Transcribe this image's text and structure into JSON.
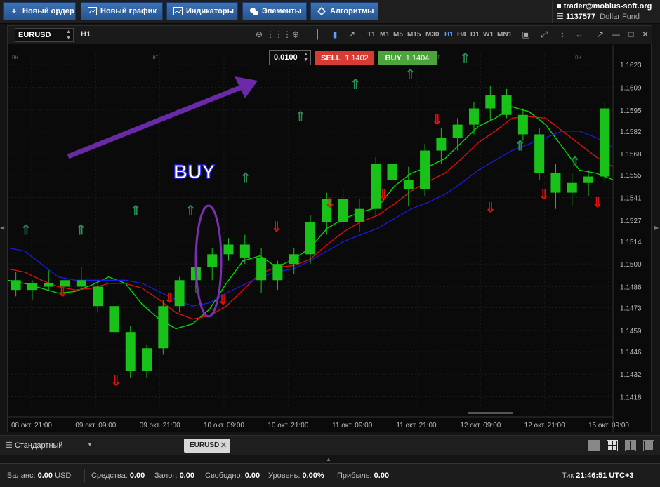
{
  "toolbar": {
    "buttons": [
      {
        "label": "Новый ордер",
        "icon": "plus-icon"
      },
      {
        "label": "Новый график",
        "icon": "chart-icon"
      },
      {
        "label": "Индикаторы",
        "icon": "indicator-icon"
      },
      {
        "label": "Элементы",
        "icon": "shapes-icon"
      },
      {
        "label": "Алгоритмы",
        "icon": "diamond-icon"
      }
    ],
    "user_email": "trader@mobius-soft.org",
    "account_number": "1137577",
    "account_type": "Dollar Fund"
  },
  "chart_toolbar": {
    "symbol": "EURUSD",
    "timeframe": "H1",
    "timeframes": [
      "T1",
      "M1",
      "M5",
      "M15",
      "M30",
      "H1",
      "H4",
      "D1",
      "W1",
      "MN1"
    ],
    "active_timeframe": "H1"
  },
  "order": {
    "lot": "0.0100",
    "sell_label": "SELL",
    "sell_price": "1.1402",
    "buy_label": "BUY",
    "buy_price": "1.1404"
  },
  "annotation": {
    "text": "BUY",
    "arrow_color": "#6a2aa8"
  },
  "chart_data": {
    "type": "candlestick",
    "symbol": "EURUSD",
    "timeframe": "H1",
    "y_ticks": [
      "1.1623",
      "1.1609",
      "1.1595",
      "1.1582",
      "1.1568",
      "1.1555",
      "1.1541",
      "1.1527",
      "1.1514",
      "1.1500",
      "1.1486",
      "1.1473",
      "1.1459",
      "1.1446",
      "1.1432",
      "1.1418"
    ],
    "ylim": [
      1.141,
      1.163
    ],
    "day_labels": [
      "пн",
      "вт",
      "ср",
      "пт",
      "пн"
    ],
    "x_ticks": [
      "08 окт. 21:00",
      "09 окт. 09:00",
      "09 окт. 21:00",
      "10 окт. 09:00",
      "10 окт. 21:00",
      "11 окт. 09:00",
      "11 окт. 21:00",
      "12 окт. 09:00",
      "12 окт. 21:00",
      "15 окт. 09:00"
    ],
    "series": [
      {
        "color": "#00e000",
        "values": [
          1.149,
          1.1488,
          1.1485,
          1.1482,
          1.1483,
          1.1487,
          1.1492,
          1.1488,
          1.1475,
          1.1466,
          1.146,
          1.1463,
          1.1472,
          1.1488,
          1.1502,
          1.1505,
          1.1498,
          1.1503,
          1.151,
          1.1522,
          1.1528,
          1.1532,
          1.1535,
          1.1548,
          1.1556,
          1.156,
          1.1565,
          1.1575,
          1.1585,
          1.159,
          1.1597,
          1.1594,
          1.1586,
          1.1572,
          1.1558,
          1.1556,
          1.1552
        ]
      },
      {
        "color": "#e01010",
        "values": [
          1.1497,
          1.1495,
          1.149,
          1.1486,
          1.1484,
          1.1485,
          1.1488,
          1.1488,
          1.1485,
          1.1478,
          1.147,
          1.1466,
          1.1468,
          1.1474,
          1.1484,
          1.1494,
          1.1498,
          1.1499,
          1.1503,
          1.1512,
          1.152,
          1.1526,
          1.153,
          1.1537,
          1.1545,
          1.1551,
          1.1556,
          1.1565,
          1.1575,
          1.1582,
          1.159,
          1.1591,
          1.159,
          1.1582,
          1.1574,
          1.1566,
          1.156
        ]
      },
      {
        "color": "#1a1ae0",
        "values": [
          1.151,
          1.1508,
          1.15,
          1.1492,
          1.149,
          1.149,
          1.149,
          1.149,
          1.1488,
          1.1483,
          1.1478,
          1.1474,
          1.1476,
          1.1482,
          1.1487,
          1.1492,
          1.1495,
          1.1497,
          1.1502,
          1.1508,
          1.1514,
          1.1518,
          1.1522,
          1.1528,
          1.1534,
          1.1538,
          1.1543,
          1.155,
          1.1558,
          1.1564,
          1.157,
          1.1574,
          1.1578,
          1.1582,
          1.1582,
          1.1578,
          1.1572
        ]
      }
    ],
    "candles": [
      [
        1.149,
        1.1495,
        1.148,
        1.1484
      ],
      [
        1.1484,
        1.149,
        1.1478,
        1.1488
      ],
      [
        1.1488,
        1.1496,
        1.1484,
        1.1486
      ],
      [
        1.1486,
        1.1492,
        1.148,
        1.149
      ],
      [
        1.149,
        1.1498,
        1.1484,
        1.1486
      ],
      [
        1.1486,
        1.149,
        1.147,
        1.1474
      ],
      [
        1.1474,
        1.1478,
        1.1455,
        1.1458
      ],
      [
        1.1458,
        1.1462,
        1.143,
        1.1434
      ],
      [
        1.1434,
        1.145,
        1.143,
        1.1448
      ],
      [
        1.1448,
        1.1478,
        1.1444,
        1.1474
      ],
      [
        1.1474,
        1.1492,
        1.147,
        1.149
      ],
      [
        1.149,
        1.15,
        1.1482,
        1.1498
      ],
      [
        1.1498,
        1.151,
        1.149,
        1.1506
      ],
      [
        1.1506,
        1.1516,
        1.1502,
        1.1512
      ],
      [
        1.1512,
        1.1518,
        1.15,
        1.1504
      ],
      [
        1.1504,
        1.151,
        1.1482,
        1.149
      ],
      [
        1.149,
        1.1502,
        1.1484,
        1.15
      ],
      [
        1.15,
        1.151,
        1.1494,
        1.1506
      ],
      [
        1.1506,
        1.153,
        1.15,
        1.1526
      ],
      [
        1.1526,
        1.1544,
        1.1518,
        1.154
      ],
      [
        1.154,
        1.1546,
        1.1522,
        1.1526
      ],
      [
        1.1526,
        1.154,
        1.152,
        1.1534
      ],
      [
        1.1534,
        1.1566,
        1.153,
        1.1562
      ],
      [
        1.1562,
        1.1568,
        1.1548,
        1.1552
      ],
      [
        1.1552,
        1.156,
        1.1536,
        1.1546
      ],
      [
        1.1546,
        1.1574,
        1.1542,
        1.157
      ],
      [
        1.157,
        1.1584,
        1.1562,
        1.1578
      ],
      [
        1.1578,
        1.159,
        1.157,
        1.1586
      ],
      [
        1.1586,
        1.16,
        1.158,
        1.1596
      ],
      [
        1.1596,
        1.161,
        1.1588,
        1.1604
      ],
      [
        1.1604,
        1.1608,
        1.159,
        1.1592
      ],
      [
        1.1592,
        1.1596,
        1.1576,
        1.158
      ],
      [
        1.158,
        1.1584,
        1.1552,
        1.1556
      ],
      [
        1.1556,
        1.1562,
        1.1534,
        1.1544
      ],
      [
        1.1544,
        1.1556,
        1.1536,
        1.155
      ],
      [
        1.155,
        1.1558,
        1.1542,
        1.1554
      ],
      [
        1.1554,
        1.16,
        1.155,
        1.1596
      ]
    ],
    "up_signals": [
      1.1518,
      1.1518,
      1.153,
      1.153,
      1.155,
      1.1588,
      1.1608,
      1.1614,
      1.1624,
      1.157,
      1.156
    ],
    "down_signals": [
      1.148,
      1.1425,
      1.1476,
      1.1475,
      1.152,
      1.1535,
      1.154,
      1.1586,
      1.1532,
      1.154,
      1.1535
    ]
  },
  "bottom_tabs": {
    "layout_label": "Стандартный",
    "tab_label": "EURUSD"
  },
  "status": {
    "balance_label": "Баланс:",
    "balance_value": "0.00",
    "balance_currency": "USD",
    "funds_label": "Средства:",
    "funds_value": "0.00",
    "margin_label": "Залог:",
    "margin_value": "0.00",
    "free_label": "Свободно:",
    "free_value": "0.00",
    "level_label": "Уровень:",
    "level_value": "0.00%",
    "profit_label": "Прибыль:",
    "profit_value": "0.00",
    "tick_label": "Тик",
    "time_value": "21:46:51",
    "tz_value": "UTC+3"
  }
}
